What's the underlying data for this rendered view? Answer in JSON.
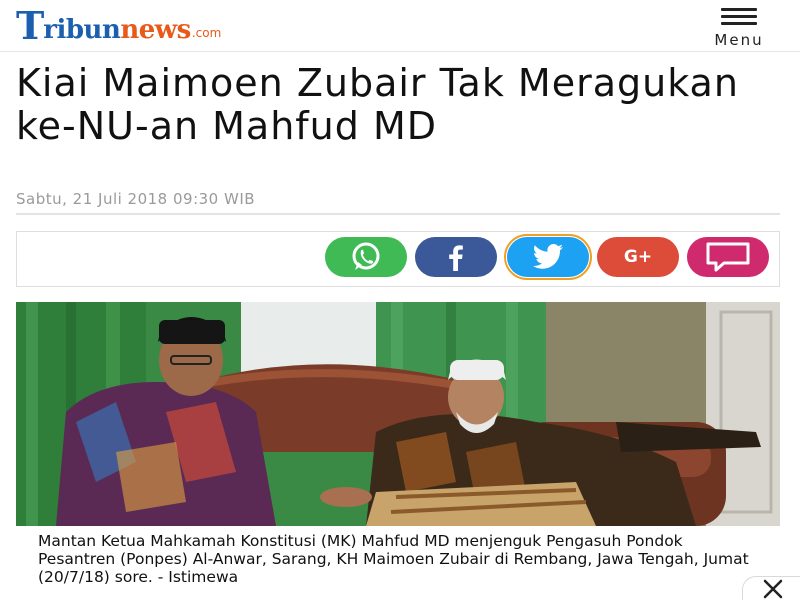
{
  "header": {
    "logo_mark": "T",
    "logo_tribun": "ribun",
    "logo_news": "news",
    "logo_com": ".com",
    "menu_label": "Menu"
  },
  "article": {
    "headline": "Kiai Maimoen Zubair Tak Meragukan ke-NU-an Mahfud MD",
    "date": "Sabtu, 21 Juli 2018 09:30 WIB",
    "caption": "Mantan Ketua Mahkamah Konstitusi (MK) Mahfud MD menjenguk Pengasuh Pondok Pesantren (Ponpes) Al-Anwar, Sarang, KH Maimoen Zubair di Rembang, Jawa Tengah, Jumat (20/7/18) sore. - Istimewa"
  },
  "share": {
    "buttons": [
      {
        "icon": "whatsapp-icon",
        "color": "#3fba54"
      },
      {
        "icon": "facebook-icon",
        "color": "#3b5998"
      },
      {
        "icon": "twitter-icon",
        "color": "#1da1f2"
      },
      {
        "icon": "google-plus-icon",
        "color": "#dd4b39",
        "label": "G+"
      },
      {
        "icon": "comment-icon",
        "color": "#cf2a6e"
      }
    ]
  },
  "colors": {
    "brand_blue": "#1b5fae",
    "brand_orange": "#e85a1a",
    "date_gray": "#9a9a9a"
  }
}
